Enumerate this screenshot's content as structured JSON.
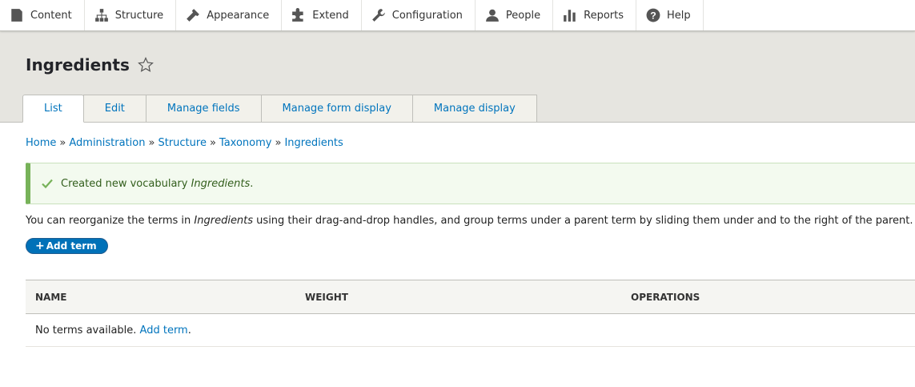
{
  "toolbar": {
    "items": [
      {
        "label": "Content",
        "icon": "content-icon"
      },
      {
        "label": "Structure",
        "icon": "structure-icon"
      },
      {
        "label": "Appearance",
        "icon": "appearance-icon"
      },
      {
        "label": "Extend",
        "icon": "extend-icon"
      },
      {
        "label": "Configuration",
        "icon": "configuration-icon"
      },
      {
        "label": "People",
        "icon": "people-icon"
      },
      {
        "label": "Reports",
        "icon": "reports-icon"
      },
      {
        "label": "Help",
        "icon": "help-icon"
      }
    ]
  },
  "header": {
    "title": "Ingredients",
    "tabs": [
      {
        "label": "List",
        "active": true
      },
      {
        "label": "Edit"
      },
      {
        "label": "Manage fields"
      },
      {
        "label": "Manage form display"
      },
      {
        "label": "Manage display"
      }
    ]
  },
  "breadcrumb": {
    "items": [
      "Home",
      "Administration",
      "Structure",
      "Taxonomy",
      "Ingredients"
    ],
    "separator": "»"
  },
  "message": {
    "prefix": "Created new vocabulary ",
    "emphasis": "Ingredients",
    "suffix": "."
  },
  "help": {
    "prefix": "You can reorganize the terms in ",
    "emphasis": "Ingredients",
    "suffix": " using their drag-and-drop handles, and group terms under a parent term by sliding them under and to the right of the parent."
  },
  "add_button": {
    "plus": "+",
    "label": "Add term"
  },
  "table": {
    "headers": [
      "NAME",
      "WEIGHT",
      "OPERATIONS"
    ],
    "empty_text": "No terms available. ",
    "empty_link": "Add term",
    "empty_suffix": "."
  },
  "colors": {
    "link": "#0074bd",
    "status_green": "#77b259",
    "button_blue": "#0071b8"
  }
}
